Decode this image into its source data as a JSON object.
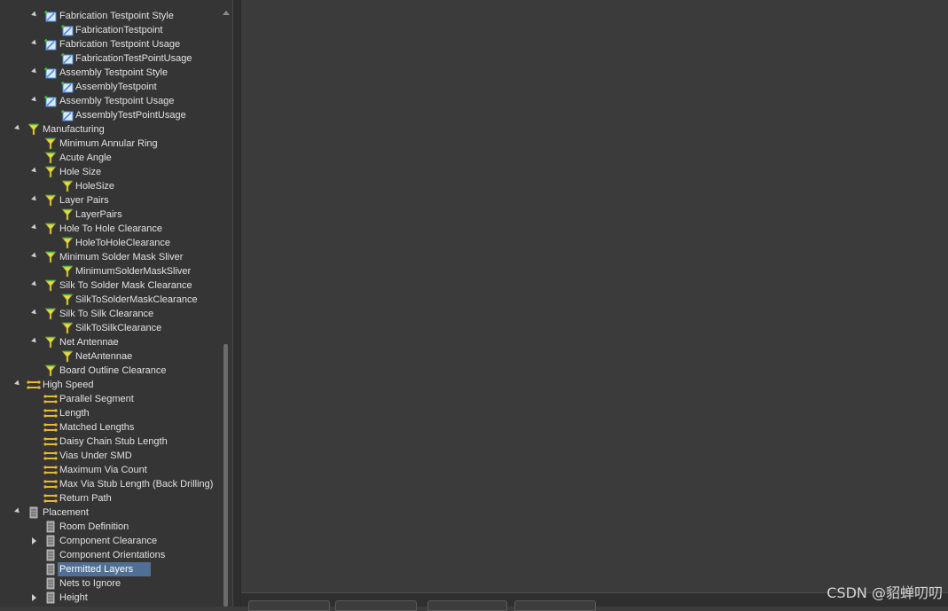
{
  "tree": {
    "rows": [
      {
        "label": "Fabrication Testpoint Style",
        "icon": "testpoint-icon",
        "level": 2,
        "caret": "open"
      },
      {
        "label": "FabricationTestpoint",
        "icon": "testpoint-icon",
        "level": 3,
        "caret": ""
      },
      {
        "label": "Fabrication Testpoint Usage",
        "icon": "testpoint-icon",
        "level": 2,
        "caret": "open"
      },
      {
        "label": "FabricationTestPointUsage",
        "icon": "testpoint-icon",
        "level": 3,
        "caret": ""
      },
      {
        "label": "Assembly Testpoint Style",
        "icon": "testpoint-icon",
        "level": 2,
        "caret": "open"
      },
      {
        "label": "AssemblyTestpoint",
        "icon": "testpoint-icon",
        "level": 3,
        "caret": ""
      },
      {
        "label": "Assembly Testpoint Usage",
        "icon": "testpoint-icon",
        "level": 2,
        "caret": "open"
      },
      {
        "label": "AssemblyTestPointUsage",
        "icon": "testpoint-icon",
        "level": 3,
        "caret": ""
      },
      {
        "label": "Manufacturing",
        "icon": "manufacturing-icon",
        "level": 1,
        "caret": "open"
      },
      {
        "label": "Minimum Annular Ring",
        "icon": "manufacturing-icon",
        "level": 2,
        "caret": ""
      },
      {
        "label": "Acute Angle",
        "icon": "manufacturing-icon",
        "level": 2,
        "caret": ""
      },
      {
        "label": "Hole Size",
        "icon": "manufacturing-icon",
        "level": 2,
        "caret": "open"
      },
      {
        "label": "HoleSize",
        "icon": "manufacturing-icon",
        "level": 3,
        "caret": ""
      },
      {
        "label": "Layer Pairs",
        "icon": "manufacturing-icon",
        "level": 2,
        "caret": "open"
      },
      {
        "label": "LayerPairs",
        "icon": "manufacturing-icon",
        "level": 3,
        "caret": ""
      },
      {
        "label": "Hole To Hole Clearance",
        "icon": "manufacturing-icon",
        "level": 2,
        "caret": "open"
      },
      {
        "label": "HoleToHoleClearance",
        "icon": "manufacturing-icon",
        "level": 3,
        "caret": ""
      },
      {
        "label": "Minimum Solder Mask Sliver",
        "icon": "manufacturing-icon",
        "level": 2,
        "caret": "open"
      },
      {
        "label": "MinimumSolderMaskSliver",
        "icon": "manufacturing-icon",
        "level": 3,
        "caret": ""
      },
      {
        "label": "Silk To Solder Mask Clearance",
        "icon": "manufacturing-icon",
        "level": 2,
        "caret": "open"
      },
      {
        "label": "SilkToSolderMaskClearance",
        "icon": "manufacturing-icon",
        "level": 3,
        "caret": ""
      },
      {
        "label": "Silk To Silk Clearance",
        "icon": "manufacturing-icon",
        "level": 2,
        "caret": "open"
      },
      {
        "label": "SilkToSilkClearance",
        "icon": "manufacturing-icon",
        "level": 3,
        "caret": ""
      },
      {
        "label": "Net Antennae",
        "icon": "manufacturing-icon",
        "level": 2,
        "caret": "open"
      },
      {
        "label": "NetAntennae",
        "icon": "manufacturing-icon",
        "level": 3,
        "caret": ""
      },
      {
        "label": "Board Outline Clearance",
        "icon": "manufacturing-icon",
        "level": 2,
        "caret": ""
      },
      {
        "label": "High Speed",
        "icon": "high-speed-icon",
        "level": 1,
        "caret": "open"
      },
      {
        "label": "Parallel Segment",
        "icon": "high-speed-icon",
        "level": 2,
        "caret": ""
      },
      {
        "label": "Length",
        "icon": "high-speed-icon",
        "level": 2,
        "caret": ""
      },
      {
        "label": "Matched Lengths",
        "icon": "high-speed-icon",
        "level": 2,
        "caret": ""
      },
      {
        "label": "Daisy Chain Stub Length",
        "icon": "high-speed-icon",
        "level": 2,
        "caret": ""
      },
      {
        "label": "Vias Under SMD",
        "icon": "high-speed-icon",
        "level": 2,
        "caret": ""
      },
      {
        "label": "Maximum Via Count",
        "icon": "high-speed-icon",
        "level": 2,
        "caret": ""
      },
      {
        "label": "Max Via Stub Length (Back Drilling)",
        "icon": "high-speed-icon",
        "level": 2,
        "caret": ""
      },
      {
        "label": "Return Path",
        "icon": "high-speed-icon",
        "level": 2,
        "caret": ""
      },
      {
        "label": "Placement",
        "icon": "placement-icon",
        "level": 1,
        "caret": "open"
      },
      {
        "label": "Room Definition",
        "icon": "placement-icon",
        "level": 2,
        "caret": ""
      },
      {
        "label": "Component Clearance",
        "icon": "placement-icon",
        "level": 2,
        "caret": "closed"
      },
      {
        "label": "Component Orientations",
        "icon": "placement-icon",
        "level": 2,
        "caret": ""
      },
      {
        "label": "Permitted Layers",
        "icon": "placement-icon",
        "level": 2,
        "caret": "",
        "selected": true
      },
      {
        "label": "Nets to Ignore",
        "icon": "placement-icon",
        "level": 2,
        "caret": ""
      },
      {
        "label": "Height",
        "icon": "placement-icon",
        "level": 2,
        "caret": "closed"
      }
    ]
  },
  "watermark": "CSDN @貂蝉叨叨",
  "colors": {
    "selection": "#4f6f95",
    "manufacturing_icon": "#e8d84a",
    "high_speed_icon": "#e8b830",
    "testpoint_icon": "#4a8ee8"
  }
}
